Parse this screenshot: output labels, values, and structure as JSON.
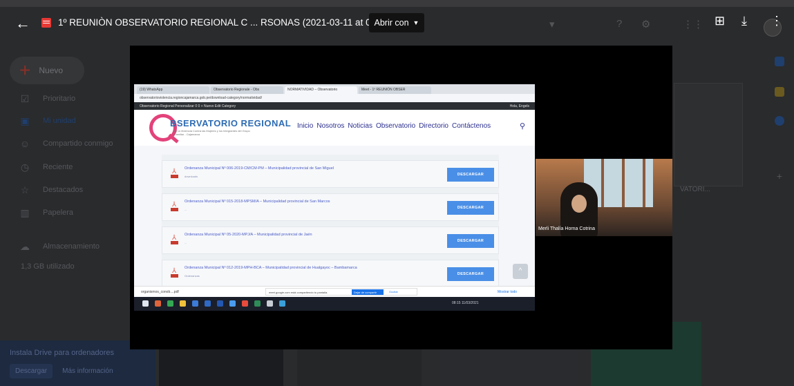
{
  "viewer": {
    "back_icon": "arrow-left-icon",
    "file_icon": "video-file-icon",
    "title": "1º REUNIÒN OBSERVATORIO REGIONAL C ... RSONAS (2021-03-11 at 07:10 GMT-8)",
    "open_with_label": "Abrir con",
    "actions": [
      "add-to-drive-icon",
      "download-icon",
      "more-vert-icon"
    ]
  },
  "drive": {
    "new_label": "Nuevo",
    "nav": [
      {
        "label": "Prioritario",
        "icon": "check-circle-icon"
      },
      {
        "label": "Mi unidad",
        "icon": "drive-icon"
      },
      {
        "label": "Compartido conmigo",
        "icon": "people-icon"
      },
      {
        "label": "Reciente",
        "icon": "clock-icon"
      },
      {
        "label": "Destacados",
        "icon": "star-icon"
      },
      {
        "label": "Papelera",
        "icon": "trash-icon"
      },
      {
        "label": "Almacenamiento",
        "icon": "cloud-icon"
      }
    ],
    "storage_used": "1,3 GB utilizado",
    "install_banner": "Instala Drive para ordenadores",
    "install_download": "Descargar",
    "install_more": "Más información",
    "file_snippet": "VATORI..."
  },
  "shared_screen": {
    "tabs": [
      "(19) WhatsApp",
      "Observatorio Regionale - Obs",
      "NORMATIVIDAD – Observatorio",
      "Meet - 1º REUNIÓN OBSER"
    ],
    "url": "observatorioviolencia.regioncajamarca.gob.pe/download-category/normatividad/",
    "wp_admin": "Observatorio Regional   Personalizar   0   0   + Nuevo   Edit Category",
    "wp_user": "Hola, Engels",
    "site_logo": "BSERVATORIO REGIONAL",
    "site_sub": "de la Violencia Contra las Mujeres y los Integrantes del Grupo Familiar - Cajamarca",
    "menu": [
      "Inicio",
      "Nosotros",
      "Noticias",
      "Observatorio",
      "Directorio",
      "Contáctenos"
    ],
    "documents": [
      {
        "name": "Ordenanza Municipal Nº 006-2019-CM/CM-PM – Municipalidad provincial de San Miguel",
        "meta": "downloads"
      },
      {
        "name": "Ordenanza Municipal Nº 015-2018-MPSM/A – Municipalidad provincial de San Marcos",
        "meta": "..."
      },
      {
        "name": "Ordenanza Municipal Nº 05-2020-MPJ/A – Municipalidad provincial de Jaén",
        "meta": "..."
      },
      {
        "name": "Ordenanza Municipal Nº 012-2019-MPH-BCA – Municipalidad provincial de Hualgayoc – Bambamarca",
        "meta": "Ordenanzas"
      }
    ],
    "download_label": "DESCARGAR",
    "download_file": "organismos_conob....pdf",
    "share_notice": "meet.google.com está compartiendo tu pantalla.",
    "stop_sharing": "Dejar de compartir",
    "hide": "Ocultar",
    "show_all": "Mostrar todo",
    "tray_time": "08:15  11/03/2021"
  },
  "camera": {
    "participant_name": "Merli Thalía Horna Cotrina"
  }
}
